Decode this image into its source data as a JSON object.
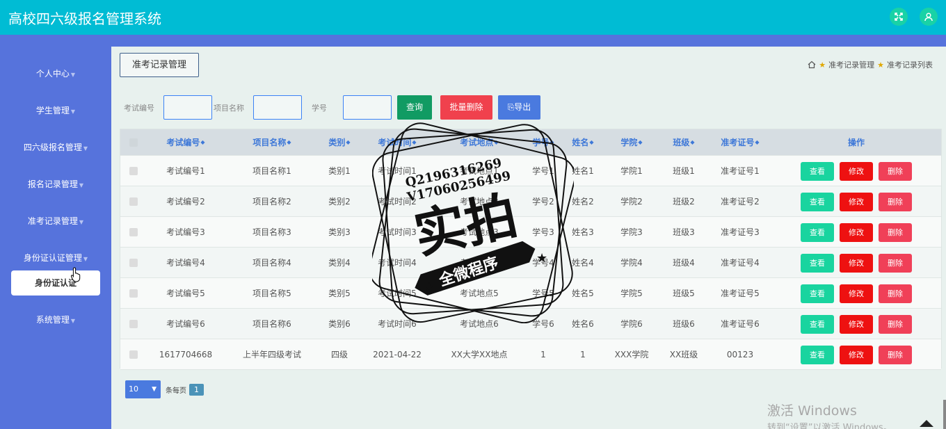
{
  "app": {
    "title": "高校四六级报名管理系统"
  },
  "topbar": {
    "fullscreen_icon": "expand-icon",
    "user_icon": "user-icon"
  },
  "sidebar": {
    "items": [
      {
        "label": "个人中心"
      },
      {
        "label": "学生管理"
      },
      {
        "label": "四六级报名管理"
      },
      {
        "label": "报名记录管理"
      },
      {
        "label": "准考记录管理"
      },
      {
        "label": "身份证认证管理"
      },
      {
        "label": "系统管理"
      }
    ],
    "active_sub": "身份证认证"
  },
  "tab": {
    "label": "准考记录管理"
  },
  "breadcrumb": {
    "home_icon": "home-icon",
    "level1": "准考记录管理",
    "level2": "准考记录列表"
  },
  "search": {
    "exam_no_label": "考试编号",
    "project_label": "项目名称",
    "student_no_label": "学号",
    "query_label": "查询",
    "batch_delete_label": "批量删除",
    "export_label": "导出"
  },
  "table": {
    "columns": [
      "考试编号",
      "项目名称",
      "类别",
      "考试时间",
      "考试地点",
      "学号",
      "姓名",
      "学院",
      "班级",
      "准考证号",
      "操作"
    ],
    "rows": [
      [
        "考试编号1",
        "项目名称1",
        "类别1",
        "考试时间1",
        "考试地点1",
        "学号1",
        "姓名1",
        "学院1",
        "班级1",
        "准考证号1"
      ],
      [
        "考试编号2",
        "项目名称2",
        "类别2",
        "考试时间2",
        "考试地点2",
        "学号2",
        "姓名2",
        "学院2",
        "班级2",
        "准考证号2"
      ],
      [
        "考试编号3",
        "项目名称3",
        "类别3",
        "考试时间3",
        "考试地点3",
        "学号3",
        "姓名3",
        "学院3",
        "班级3",
        "准考证号3"
      ],
      [
        "考试编号4",
        "项目名称4",
        "类别4",
        "考试时间4",
        "考试地点4",
        "学号4",
        "姓名4",
        "学院4",
        "班级4",
        "准考证号4"
      ],
      [
        "考试编号5",
        "项目名称5",
        "类别5",
        "考试时间5",
        "考试地点5",
        "学号5",
        "姓名5",
        "学院5",
        "班级5",
        "准考证号5"
      ],
      [
        "考试编号6",
        "项目名称6",
        "类别6",
        "考试时间6",
        "考试地点6",
        "学号6",
        "姓名6",
        "学院6",
        "班级6",
        "准考证号6"
      ],
      [
        "1617704668",
        "上半年四级考试",
        "四级",
        "2021-04-22",
        "XX大学XX地点",
        "1",
        "1",
        "XXX学院",
        "XX班级",
        "00123"
      ]
    ],
    "actions": {
      "view": "查看",
      "edit": "修改",
      "delete": "删除"
    }
  },
  "pagination": {
    "page_size": "10",
    "per_page_label": "条每页",
    "current_page": "1"
  },
  "watermark": {
    "line1": "Q2196316269",
    "line2": "V17060256499",
    "main": "实拍",
    "banner": "全微程序"
  },
  "os_overlay": {
    "line1": "激活 Windows",
    "line2": "转到“设置”以激活 Windows。"
  },
  "colors": {
    "header": "#00bcd4",
    "sidebar": "#5673dc",
    "view": "#19d49f",
    "edit": "#ee1111",
    "delete": "#f04058",
    "query": "#119b63",
    "batch_delete": "#f0414d",
    "export": "#4a7adf"
  }
}
